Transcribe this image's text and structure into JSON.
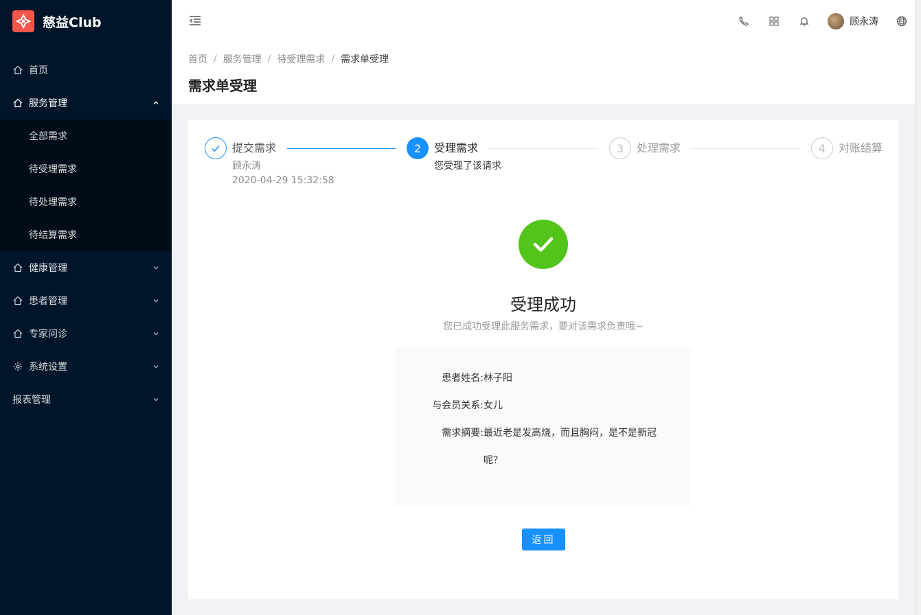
{
  "brand": {
    "name": "慈益Club"
  },
  "sidebar": {
    "items": [
      {
        "label": "首页",
        "icon": "home-icon"
      },
      {
        "label": "服务管理",
        "icon": "home-icon",
        "expanded": true,
        "children": [
          {
            "label": "全部需求"
          },
          {
            "label": "待受理需求"
          },
          {
            "label": "待处理需求"
          },
          {
            "label": "待结算需求"
          }
        ]
      },
      {
        "label": "健康管理",
        "icon": "home-icon"
      },
      {
        "label": "患者管理",
        "icon": "home-icon"
      },
      {
        "label": "专家问诊",
        "icon": "home-icon"
      },
      {
        "label": "系统设置",
        "icon": "gear-icon"
      },
      {
        "label": "报表管理"
      }
    ]
  },
  "header": {
    "user_name": "顾永涛",
    "icons": [
      "phone-icon",
      "apps-icon",
      "bell-icon",
      "globe-icon"
    ]
  },
  "breadcrumb": [
    "首页",
    "服务管理",
    "待受理需求",
    "需求单受理"
  ],
  "page_title": "需求单受理",
  "steps": [
    {
      "title": "提交需求",
      "desc1": "顾永涛",
      "desc2": "2020-04-29 15:32:58",
      "status": "finish"
    },
    {
      "number": "2",
      "title": "受理需求",
      "desc1": "您受理了该请求",
      "status": "process"
    },
    {
      "number": "3",
      "title": "处理需求",
      "status": "wait"
    },
    {
      "number": "4",
      "title": "对账结算",
      "status": "wait"
    }
  ],
  "result": {
    "title": "受理成功",
    "subtitle": "您已成功受理此服务需求，要对该需求负责哦~",
    "success_color": "#52c41a"
  },
  "info": {
    "patient_label": "患者姓名:",
    "patient_value": "林子阳",
    "relation_label": "与会员关系:",
    "relation_value": "女儿",
    "summary_label": "需求摘要:",
    "summary_line1": "最近老是发高烧，而且胸闷，是不是新冠",
    "summary_line2": "呢？"
  },
  "actions": {
    "back_label": "返回"
  },
  "colors": {
    "primary": "#1890ff",
    "sidebar_bg": "#001529",
    "brand": "#f5564a"
  }
}
